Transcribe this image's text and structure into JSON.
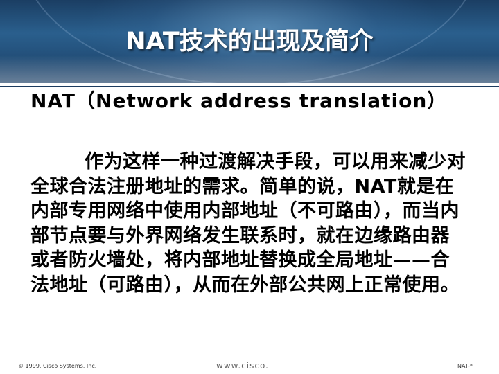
{
  "slide": {
    "title": "NAT技术的出现及简介",
    "subtitle": "NAT（Network address translation）",
    "body": "作为这样一种过渡解决手段，可以用来减少对全球合法注册地址的需求。简单的说，NAT就是在内部专用网络中使用内部地址（不可路由），而当内部节点要与外界网络发生联系时，就在边缘路由器或者防火墙处，将内部地址替换成全局地址——合法地址（可路由），从而在外部公共网上正常使用。"
  },
  "footer": {
    "copyright": "© 1999, Cisco Systems, Inc.",
    "url": "www.cisco.",
    "page": "NAT-*"
  },
  "colors": {
    "header_dark": "#1b3e63",
    "header_mid": "#2a5f8d",
    "title_text": "#ffffff"
  }
}
